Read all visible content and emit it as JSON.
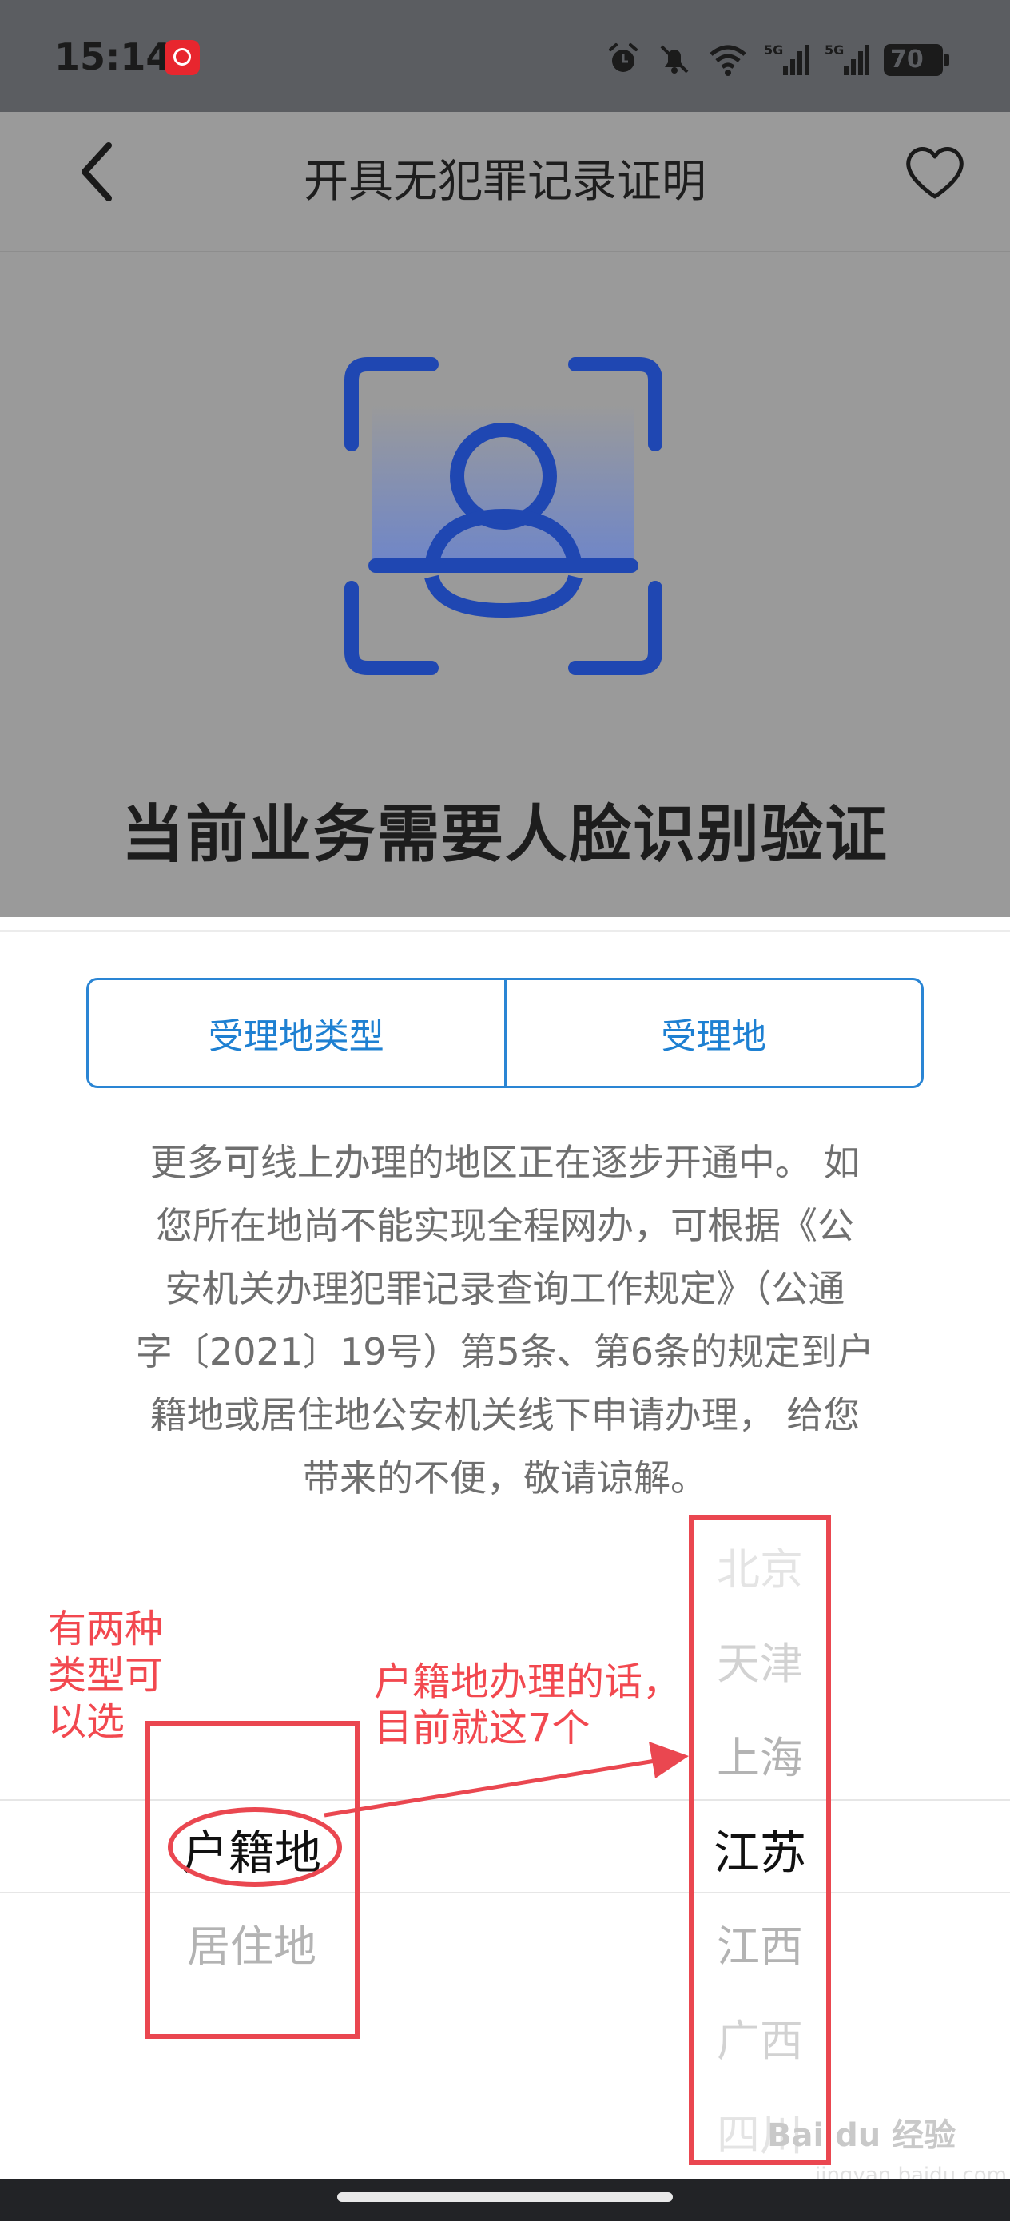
{
  "status_bar": {
    "time": "15:14",
    "battery": "70",
    "icons": [
      "app-icon",
      "alarm-icon",
      "mute-icon",
      "wifi-icon",
      "signal-5g-icon",
      "signal-5g-icon"
    ]
  },
  "nav": {
    "title": "开具无犯罪记录证明",
    "back_icon": "back-arrow-icon",
    "favorite_icon": "heart-icon"
  },
  "face_verify": {
    "title": "当前业务需要人脸识别验证",
    "icon": "face-scan-icon",
    "accent_color": "#1f47b2"
  },
  "tabs": [
    {
      "label": "受理地类型"
    },
    {
      "label": "受理地"
    }
  ],
  "notice": {
    "lines": [
      "更多可线上办理的地区正在逐步开通中。 如",
      "您所在地尚不能实现全程网办，可根据《公",
      "安机关办理犯罪记录查询工作规定》（公通",
      "字〔2021〕19号）第5条、第6条的规定到户",
      "籍地或居住地公安机关线下申请办理， 给您",
      "带来的不便，敬请谅解。"
    ]
  },
  "picker": {
    "type_options": [
      "户籍地",
      "居住地"
    ],
    "type_selected": "户籍地",
    "place_options": [
      "北京",
      "天津",
      "上海",
      "江苏",
      "江西",
      "广西",
      "四川"
    ],
    "place_selected": "江苏"
  },
  "annotations": {
    "left_note": [
      "有两种",
      "类型可",
      "以选"
    ],
    "right_note": [
      "户籍地办理的话，",
      "目前就这7个"
    ],
    "color": "#ea4750"
  },
  "watermark": {
    "brand": "Bai du 经验",
    "url": "jingyan.baidu.com"
  },
  "colors": {
    "tab_blue": "#1e80d2",
    "overlay_gray": "#9a9a9a"
  }
}
